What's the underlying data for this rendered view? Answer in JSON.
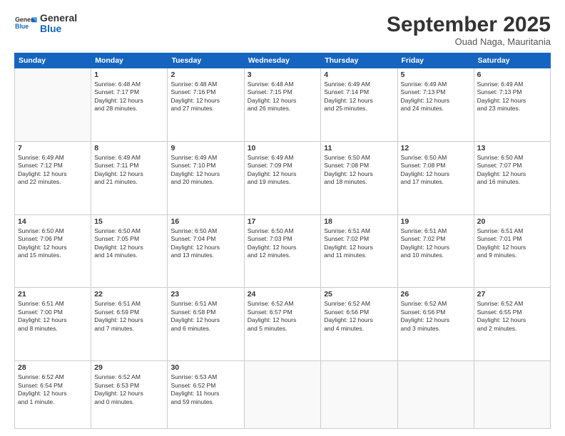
{
  "header": {
    "logo_line1": "General",
    "logo_line2": "Blue",
    "month": "September 2025",
    "location": "Ouad Naga, Mauritania"
  },
  "weekdays": [
    "Sunday",
    "Monday",
    "Tuesday",
    "Wednesday",
    "Thursday",
    "Friday",
    "Saturday"
  ],
  "weeks": [
    [
      {
        "day": null
      },
      {
        "day": "1",
        "sunrise": "6:48 AM",
        "sunset": "7:17 PM",
        "daylight": "12 hours and 28 minutes."
      },
      {
        "day": "2",
        "sunrise": "6:48 AM",
        "sunset": "7:16 PM",
        "daylight": "12 hours and 27 minutes."
      },
      {
        "day": "3",
        "sunrise": "6:48 AM",
        "sunset": "7:15 PM",
        "daylight": "12 hours and 26 minutes."
      },
      {
        "day": "4",
        "sunrise": "6:49 AM",
        "sunset": "7:14 PM",
        "daylight": "12 hours and 25 minutes."
      },
      {
        "day": "5",
        "sunrise": "6:49 AM",
        "sunset": "7:13 PM",
        "daylight": "12 hours and 24 minutes."
      },
      {
        "day": "6",
        "sunrise": "6:49 AM",
        "sunset": "7:13 PM",
        "daylight": "12 hours and 23 minutes."
      }
    ],
    [
      {
        "day": "7",
        "sunrise": "6:49 AM",
        "sunset": "7:12 PM",
        "daylight": "12 hours and 22 minutes."
      },
      {
        "day": "8",
        "sunrise": "6:49 AM",
        "sunset": "7:11 PM",
        "daylight": "12 hours and 21 minutes."
      },
      {
        "day": "9",
        "sunrise": "6:49 AM",
        "sunset": "7:10 PM",
        "daylight": "12 hours and 20 minutes."
      },
      {
        "day": "10",
        "sunrise": "6:49 AM",
        "sunset": "7:09 PM",
        "daylight": "12 hours and 19 minutes."
      },
      {
        "day": "11",
        "sunrise": "6:50 AM",
        "sunset": "7:08 PM",
        "daylight": "12 hours and 18 minutes."
      },
      {
        "day": "12",
        "sunrise": "6:50 AM",
        "sunset": "7:08 PM",
        "daylight": "12 hours and 17 minutes."
      },
      {
        "day": "13",
        "sunrise": "6:50 AM",
        "sunset": "7:07 PM",
        "daylight": "12 hours and 16 minutes."
      }
    ],
    [
      {
        "day": "14",
        "sunrise": "6:50 AM",
        "sunset": "7:06 PM",
        "daylight": "12 hours and 15 minutes."
      },
      {
        "day": "15",
        "sunrise": "6:50 AM",
        "sunset": "7:05 PM",
        "daylight": "12 hours and 14 minutes."
      },
      {
        "day": "16",
        "sunrise": "6:50 AM",
        "sunset": "7:04 PM",
        "daylight": "12 hours and 13 minutes."
      },
      {
        "day": "17",
        "sunrise": "6:50 AM",
        "sunset": "7:03 PM",
        "daylight": "12 hours and 12 minutes."
      },
      {
        "day": "18",
        "sunrise": "6:51 AM",
        "sunset": "7:02 PM",
        "daylight": "12 hours and 11 minutes."
      },
      {
        "day": "19",
        "sunrise": "6:51 AM",
        "sunset": "7:02 PM",
        "daylight": "12 hours and 10 minutes."
      },
      {
        "day": "20",
        "sunrise": "6:51 AM",
        "sunset": "7:01 PM",
        "daylight": "12 hours and 9 minutes."
      }
    ],
    [
      {
        "day": "21",
        "sunrise": "6:51 AM",
        "sunset": "7:00 PM",
        "daylight": "12 hours and 8 minutes."
      },
      {
        "day": "22",
        "sunrise": "6:51 AM",
        "sunset": "6:59 PM",
        "daylight": "12 hours and 7 minutes."
      },
      {
        "day": "23",
        "sunrise": "6:51 AM",
        "sunset": "6:58 PM",
        "daylight": "12 hours and 6 minutes."
      },
      {
        "day": "24",
        "sunrise": "6:52 AM",
        "sunset": "6:57 PM",
        "daylight": "12 hours and 5 minutes."
      },
      {
        "day": "25",
        "sunrise": "6:52 AM",
        "sunset": "6:56 PM",
        "daylight": "12 hours and 4 minutes."
      },
      {
        "day": "26",
        "sunrise": "6:52 AM",
        "sunset": "6:56 PM",
        "daylight": "12 hours and 3 minutes."
      },
      {
        "day": "27",
        "sunrise": "6:52 AM",
        "sunset": "6:55 PM",
        "daylight": "12 hours and 2 minutes."
      }
    ],
    [
      {
        "day": "28",
        "sunrise": "6:52 AM",
        "sunset": "6:54 PM",
        "daylight": "12 hours and 1 minute."
      },
      {
        "day": "29",
        "sunrise": "6:52 AM",
        "sunset": "6:53 PM",
        "daylight": "12 hours and 0 minutes."
      },
      {
        "day": "30",
        "sunrise": "6:53 AM",
        "sunset": "6:52 PM",
        "daylight": "11 hours and 59 minutes."
      },
      {
        "day": null
      },
      {
        "day": null
      },
      {
        "day": null
      },
      {
        "day": null
      }
    ]
  ]
}
